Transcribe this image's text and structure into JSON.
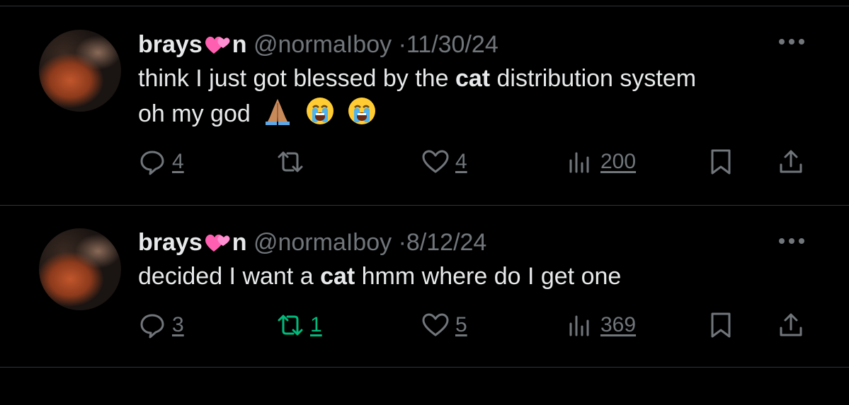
{
  "tweets": [
    {
      "display_name_a": "brays",
      "display_name_b": "n",
      "handle": "@normaIboy",
      "separator": "·",
      "date": "11/30/24",
      "text_before": "think I just got blessed by the ",
      "text_bold": "cat",
      "text_after_line1": " distribution system",
      "text_line2": "oh my god",
      "emojis": [
        "folded-hands-emoji",
        "loudly-crying-emoji",
        "loudly-crying-emoji"
      ],
      "actions": {
        "replies": "4",
        "reposts": "",
        "likes": "4",
        "views": "200"
      },
      "reposted": false
    },
    {
      "display_name_a": "brays",
      "display_name_b": "n",
      "handle": "@normaIboy",
      "separator": "·",
      "date": "8/12/24",
      "text_before": "decided I want a ",
      "text_bold": "cat",
      "text_after_line1": " hmm where do I get one",
      "actions": {
        "replies": "3",
        "reposts": "1",
        "likes": "5",
        "views": "369"
      },
      "reposted": true
    }
  ],
  "colors": {
    "background": "#000000",
    "text": "#e7e9ea",
    "muted": "#71767b",
    "repost_active": "#00ba7c",
    "divider": "#2f3336"
  }
}
